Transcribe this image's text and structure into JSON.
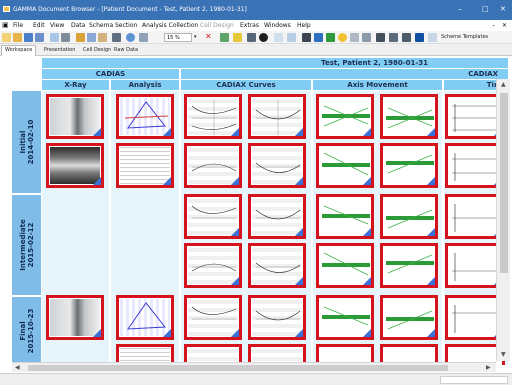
{
  "window": {
    "title": "GAMMA Document Browser - [Patient Document - Test, Patient 2, 1980-01-31]",
    "minimize": "–",
    "maximize": "□",
    "close": "✕"
  },
  "menu": [
    {
      "label": "File"
    },
    {
      "label": "Edit"
    },
    {
      "label": "View"
    },
    {
      "label": "Data"
    },
    {
      "label": "Schema"
    },
    {
      "label": "Section"
    },
    {
      "label": "Analysis Collection"
    },
    {
      "label": "Cell Design",
      "disabled": true
    },
    {
      "label": "Extras"
    },
    {
      "label": "Windows"
    },
    {
      "label": "Help"
    }
  ],
  "toolbar": {
    "zoom_value": "15 %",
    "scheme_templates_label": "Scheme Templates"
  },
  "tabs": [
    {
      "label": "Workspace",
      "active": true
    },
    {
      "label": "Presentation"
    },
    {
      "label": "Cell Design"
    },
    {
      "label": "Raw Data"
    }
  ],
  "document": {
    "patient_header": "Test, Patient 2, 1980-01-31",
    "group_cadias": "CADIAS",
    "group_cadiax": "CADIAX",
    "columns": [
      "X-Ray",
      "Analysis",
      "CADIAX Curves",
      "Axis Movement",
      "Time"
    ],
    "rows": [
      {
        "label": "Initial",
        "date": "2014-02-10"
      },
      {
        "label": "Intermediate",
        "date": "2015-02-12"
      },
      {
        "label": "Final",
        "date": "2015-10-23"
      }
    ]
  },
  "colors": {
    "title_bar": "#3a72b6",
    "header_blue": "#82cdf3",
    "row_label_blue": "#7fbde8",
    "thumb_border_red": "#d4131d",
    "corner_blue": "#3b6fd8"
  }
}
